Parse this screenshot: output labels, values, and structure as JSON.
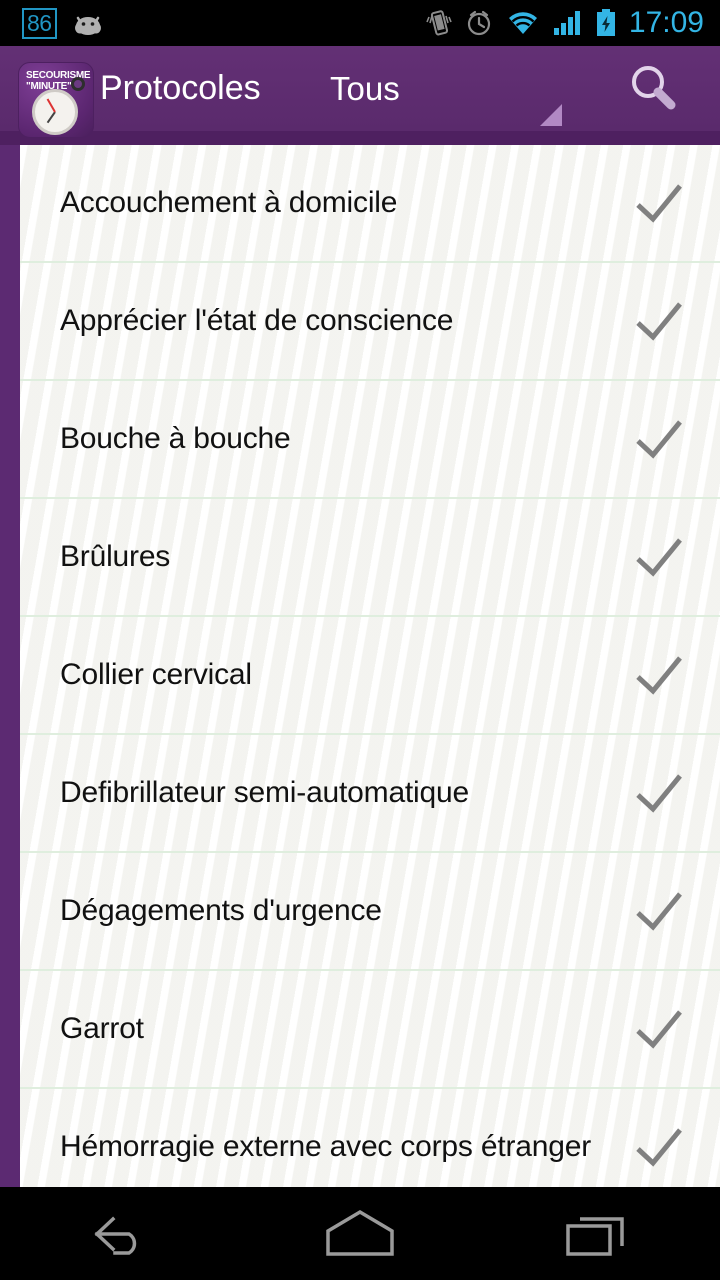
{
  "status_bar": {
    "network_badge": "86",
    "time": "17:09",
    "icons": [
      "android-head-icon",
      "vibrate-icon",
      "alarm-icon",
      "wifi-icon",
      "signal-icon",
      "battery-charging-icon"
    ],
    "accent_color": "#33b5e5",
    "badge_color": "#2196c4",
    "background": "#000000"
  },
  "action_bar": {
    "app_icon_line1": "SECOURISME",
    "app_icon_line2": "\"MINUTE\"",
    "title": "Protocoles",
    "filter_label": "Tous",
    "search_icon": "search-icon",
    "spinner_icon": "dropdown-triangle-icon",
    "background": "#5c2a72",
    "underline_color": "#4e2060",
    "text_color": "#ffffff"
  },
  "list": {
    "check_icon": "check-icon",
    "check_color": "#808080",
    "divider_color": "#dfeede",
    "items": [
      {
        "label": "Accouchement à domicile",
        "checked": true
      },
      {
        "label": "Apprécier l'état de conscience",
        "checked": true
      },
      {
        "label": "Bouche à bouche",
        "checked": true
      },
      {
        "label": "Brûlures",
        "checked": true
      },
      {
        "label": "Collier cervical",
        "checked": true
      },
      {
        "label": "Defibrillateur semi-automatique",
        "checked": true
      },
      {
        "label": "Dégagements d'urgence",
        "checked": true
      },
      {
        "label": "Garrot",
        "checked": true
      },
      {
        "label": "Hémorragie externe avec corps étranger",
        "checked": true
      }
    ]
  },
  "nav_bar": {
    "back_label": "back-icon",
    "home_label": "home-icon",
    "recents_label": "recents-icon",
    "icon_color": "#9a9a9a"
  }
}
